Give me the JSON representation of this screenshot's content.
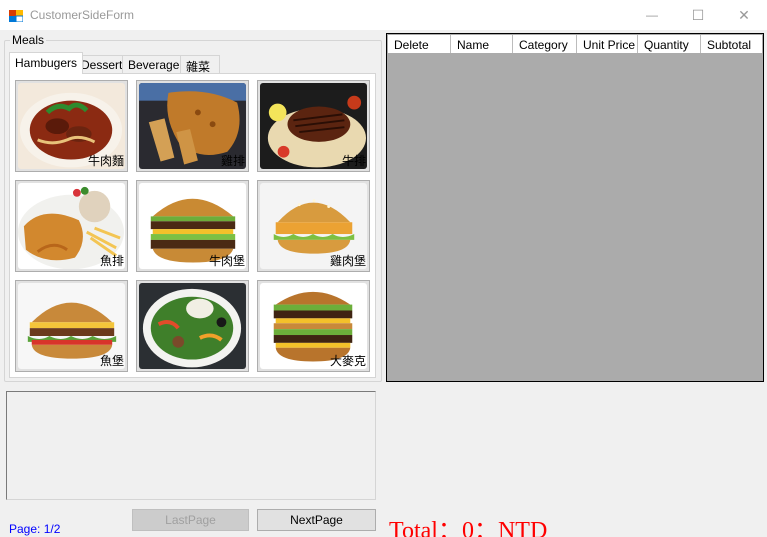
{
  "window": {
    "title": "CustomerSideForm",
    "minimize_glyph": "—",
    "maximize_glyph": "☐",
    "close_glyph": "✕"
  },
  "meals_group": {
    "label": "Meals"
  },
  "tabs": [
    {
      "label": "Hambugers",
      "active": true
    },
    {
      "label": "Dessert",
      "active": false
    },
    {
      "label": "Beverage",
      "active": false
    },
    {
      "label": "雜菜",
      "active": false
    }
  ],
  "meal_items": [
    {
      "label": "牛肉麵",
      "icon": "beef-noodle-image"
    },
    {
      "label": "雞排",
      "icon": "fried-chicken-cutlet-image"
    },
    {
      "label": "牛排",
      "icon": "steak-image"
    },
    {
      "label": "魚排",
      "icon": "fish-fillet-image"
    },
    {
      "label": "牛肉堡",
      "icon": "beef-burger-image"
    },
    {
      "label": "雞肉堡",
      "icon": "chicken-burger-image"
    },
    {
      "label": "魚堡",
      "icon": "fish-burger-image"
    },
    {
      "label": "",
      "icon": "salad-bowl-image"
    },
    {
      "label": "大麥克",
      "icon": "big-mac-image"
    }
  ],
  "order_grid": {
    "columns": [
      "Delete",
      "Name",
      "Category",
      "Unit Price",
      "Quantity",
      "Subtotal"
    ],
    "rows": []
  },
  "description_box": {
    "value": ""
  },
  "pager": {
    "last_page_label": "LastPage",
    "next_page_label": "NextPage",
    "page_text": "Page: 1/2"
  },
  "total": {
    "text": "Total：0：NTD"
  },
  "colors": {
    "total": "#ff0000",
    "page_label": "#0000ff",
    "grid_background": "#ababab"
  }
}
